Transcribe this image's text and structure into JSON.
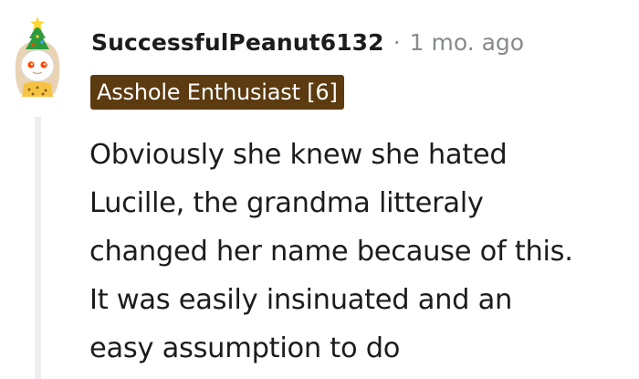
{
  "comment": {
    "author": "SuccessfulPeanut6132",
    "separator": "·",
    "timestamp": "1 mo. ago",
    "flair": "Asshole Enthusiast [6]",
    "avatar": "snoo-avatar-with-christmas-tree-hat",
    "body_lines": [
      "Obviously she knew she hated",
      "Lucille, the grandma litteraly",
      "changed her name because of this.",
      "It was easily insinuated and an",
      "easy assumption to do"
    ]
  },
  "colors": {
    "flair_background": "#5c3b10",
    "username": "#1c1c1c",
    "meta": "#878a8c",
    "thread_line": "#edeff1"
  }
}
